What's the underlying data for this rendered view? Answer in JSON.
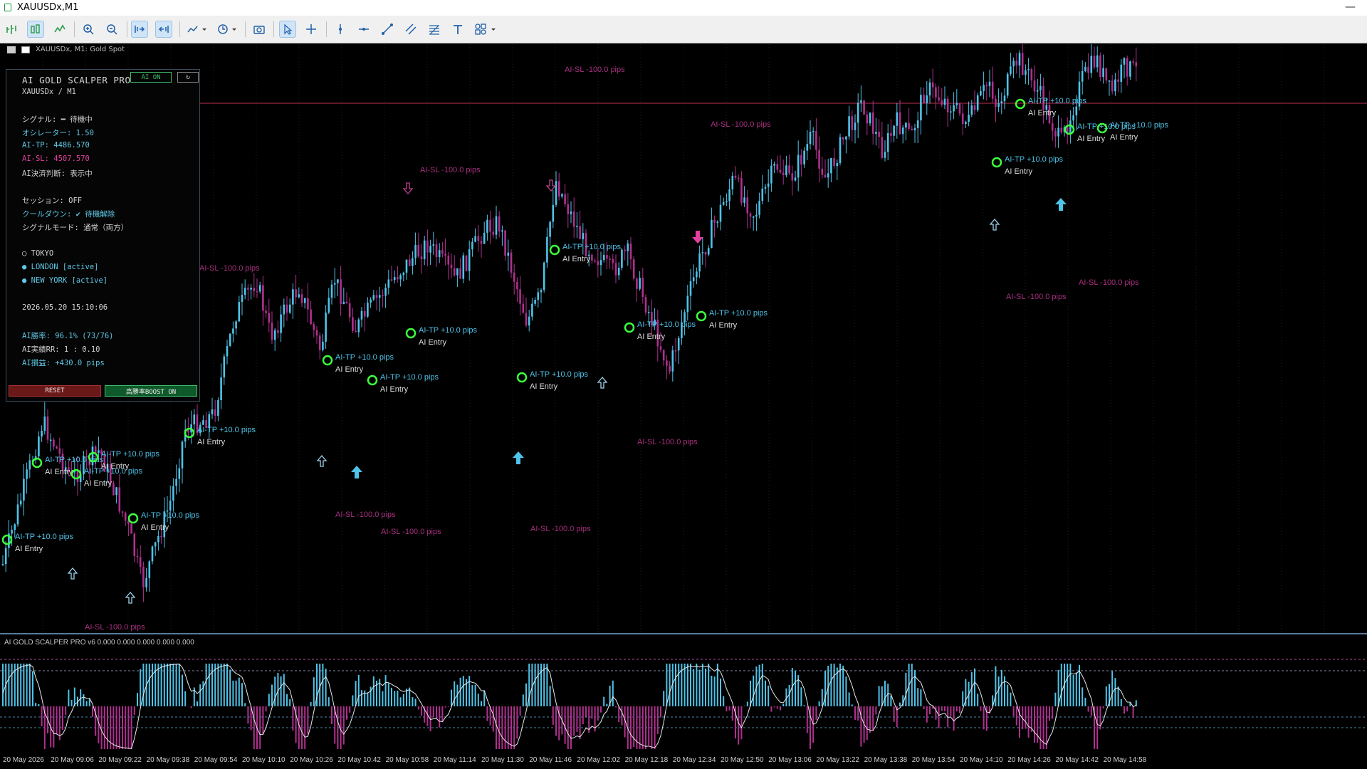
{
  "window": {
    "title": "XAUUSDx,M1"
  },
  "chart_tab": {
    "label": "XAUUSDx, M1:  Gold Spot"
  },
  "toolbar": {
    "icons": [
      "new-order-icon",
      "bar-chart-icon",
      "line-chart-icon",
      "zoom-in-icon",
      "zoom-out-icon",
      "autoscroll-icon",
      "chart-shift-icon",
      "indicators-icon",
      "periods-icon",
      "screenshot-icon",
      "cursor-icon",
      "crosshair-icon",
      "vertical-line-icon",
      "horizontal-line-icon",
      "trendline-icon",
      "channel-icon",
      "fibonacci-icon",
      "text-icon",
      "shapes-icon"
    ]
  },
  "panel": {
    "title": "AI GOLD SCALPER PRO",
    "ai_on": "AI ON",
    "refresh": "↻",
    "symbol": "XAUUSDx / M1",
    "signal": "シグナル: ━ 待機中",
    "oscillator": "オシレーター: 1.50",
    "ai_tp": "AI-TP: 4486.570",
    "ai_sl": "AI-SL: 4507.570",
    "ai_decision": "AI決済判断: 表示中",
    "session": "セッション: OFF",
    "cooldown": "クールダウン: ✔ 待機解除",
    "signal_mode": "シグナルモード: 通常（両方）",
    "tokyo": "◯ TOKYO",
    "london": "● LONDON [active]",
    "newyork": "● NEW YORK [active]",
    "datetime": "2026.05.20 15:10:06",
    "winrate": "AI勝率: 96.1% (73/76)",
    "rr": "AI実績RR: 1 : 0.10",
    "pips": "AI損益: +430.0 pips",
    "reset": "RESET",
    "boost": "高勝率BOOST ON"
  },
  "indicator_label": "AI GOLD SCALPER PRO v6 0.000 0.000 0.000 0.000 0.000",
  "time_axis": [
    "20 May 2026",
    "20 May 09:06",
    "20 May 09:22",
    "20 May 09:38",
    "20 May 09:54",
    "20 May 10:10",
    "20 May 10:26",
    "20 May 10:42",
    "20 May 10:58",
    "20 May 11:14",
    "20 May 11:30",
    "20 May 11:46",
    "20 May 12:02",
    "20 May 12:18",
    "20 May 12:34",
    "20 May 12:50",
    "20 May 13:06",
    "20 May 13:22",
    "20 May 13:38",
    "20 May 13:54",
    "20 May 14:10",
    "20 May 14:26",
    "20 May 14:42",
    "20 May 14:58"
  ],
  "chart_labels": {
    "entry": "AI Entry",
    "tp": "AI-TP  +10.0 pips",
    "sl": "AI-SL  -100.0 pips"
  },
  "colors": {
    "bull": "#4fc3e8",
    "bear": "#b0308f",
    "tp_circle": "#3cff3c",
    "sl_text": "#a8307f",
    "tp_text": "#4fc3e8",
    "panel_border": "#3a4a5a"
  }
}
